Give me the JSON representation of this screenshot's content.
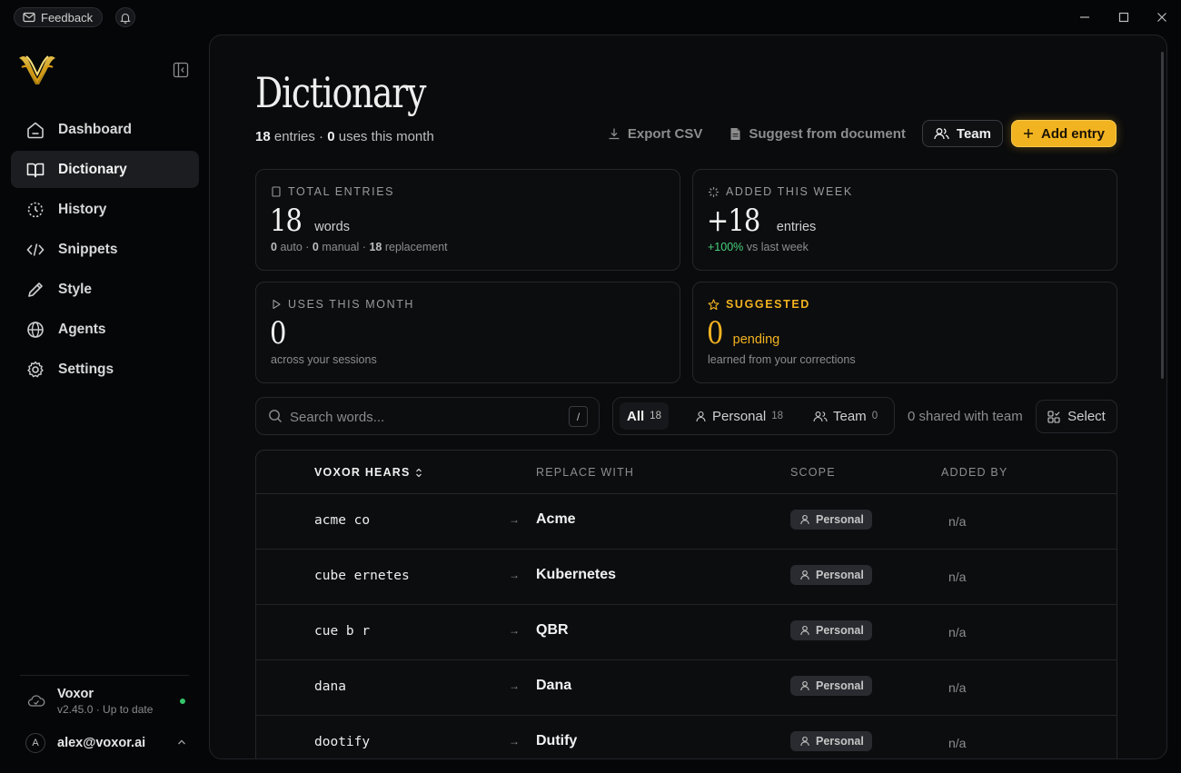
{
  "titlebar": {
    "feedback_label": "Feedback"
  },
  "sidebar": {
    "items": [
      {
        "label": "Dashboard",
        "icon": "home-icon",
        "active": false
      },
      {
        "label": "Dictionary",
        "icon": "book-icon",
        "active": true
      },
      {
        "label": "History",
        "icon": "history-icon",
        "active": false
      },
      {
        "label": "Snippets",
        "icon": "code-icon",
        "active": false
      },
      {
        "label": "Style",
        "icon": "pen-icon",
        "active": false
      },
      {
        "label": "Agents",
        "icon": "globe-icon",
        "active": false
      },
      {
        "label": "Settings",
        "icon": "gear-icon",
        "active": false
      }
    ],
    "app_name": "Voxor",
    "version": "v2.45.0 · Up to date",
    "avatar_initial": "A",
    "account_email": "alex@voxor.ai"
  },
  "header": {
    "title": "Dictionary",
    "entries_count": "18",
    "entries_label": "entries ·",
    "uses_count": "0",
    "uses_label": "uses this month",
    "export_label": "Export CSV",
    "suggest_label": "Suggest from document",
    "team_label": "Team",
    "add_label": "Add entry"
  },
  "stats": {
    "total": {
      "label": "TOTAL ENTRIES",
      "value": "18",
      "unit": "words",
      "auto": "0",
      "auto_label": "auto ·",
      "manual": "0",
      "manual_label": "manual ·",
      "replacement": "18",
      "replacement_label": "replacement"
    },
    "week": {
      "label": "ADDED THIS WEEK",
      "value": "+18",
      "unit": "entries",
      "change": "+100%",
      "change_label": "vs last week"
    },
    "uses": {
      "label": "USES THIS MONTH",
      "value": "0",
      "detail": "across your sessions"
    },
    "suggested": {
      "label": "SUGGESTED",
      "value": "0",
      "unit": "pending",
      "detail": "learned from your corrections"
    }
  },
  "filters": {
    "search_placeholder": "Search words...",
    "search_shortcut": "/",
    "tabs": [
      {
        "label": "All",
        "count": "18",
        "active": true
      },
      {
        "label": "Personal",
        "count": "18",
        "active": false
      },
      {
        "label": "Team",
        "count": "0",
        "active": false
      }
    ],
    "shared_text": "0 shared with team",
    "select_label": "Select"
  },
  "table": {
    "columns": [
      "VOXOR HEARS",
      "REPLACE WITH",
      "SCOPE",
      "ADDED BY"
    ],
    "rows": [
      {
        "hears": "acme co",
        "replace": "Acme",
        "scope": "Personal",
        "added_by": "n/a"
      },
      {
        "hears": "cube ernetes",
        "replace": "Kubernetes",
        "scope": "Personal",
        "added_by": "n/a"
      },
      {
        "hears": "cue b r",
        "replace": "QBR",
        "scope": "Personal",
        "added_by": "n/a"
      },
      {
        "hears": "dana",
        "replace": "Dana",
        "scope": "Personal",
        "added_by": "n/a"
      },
      {
        "hears": "dootify",
        "replace": "Dutify",
        "scope": "Personal",
        "added_by": "n/a"
      }
    ]
  },
  "colors": {
    "accent": "#f2b320",
    "positive": "#46d27c",
    "status_online": "#35c46a",
    "background": "#050608"
  }
}
